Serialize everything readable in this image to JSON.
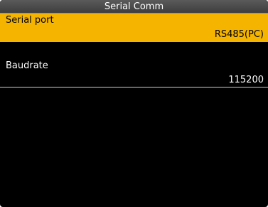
{
  "header": {
    "title": "Serial Comm"
  },
  "settings": [
    {
      "label": "Serial port",
      "value": "RS485(PC)",
      "selected": true
    },
    {
      "label": "Baudrate",
      "value": "115200",
      "selected": false
    }
  ],
  "colors": {
    "highlight": "#f4b400",
    "background": "#000000",
    "titlebar": "#4a4a4a"
  }
}
